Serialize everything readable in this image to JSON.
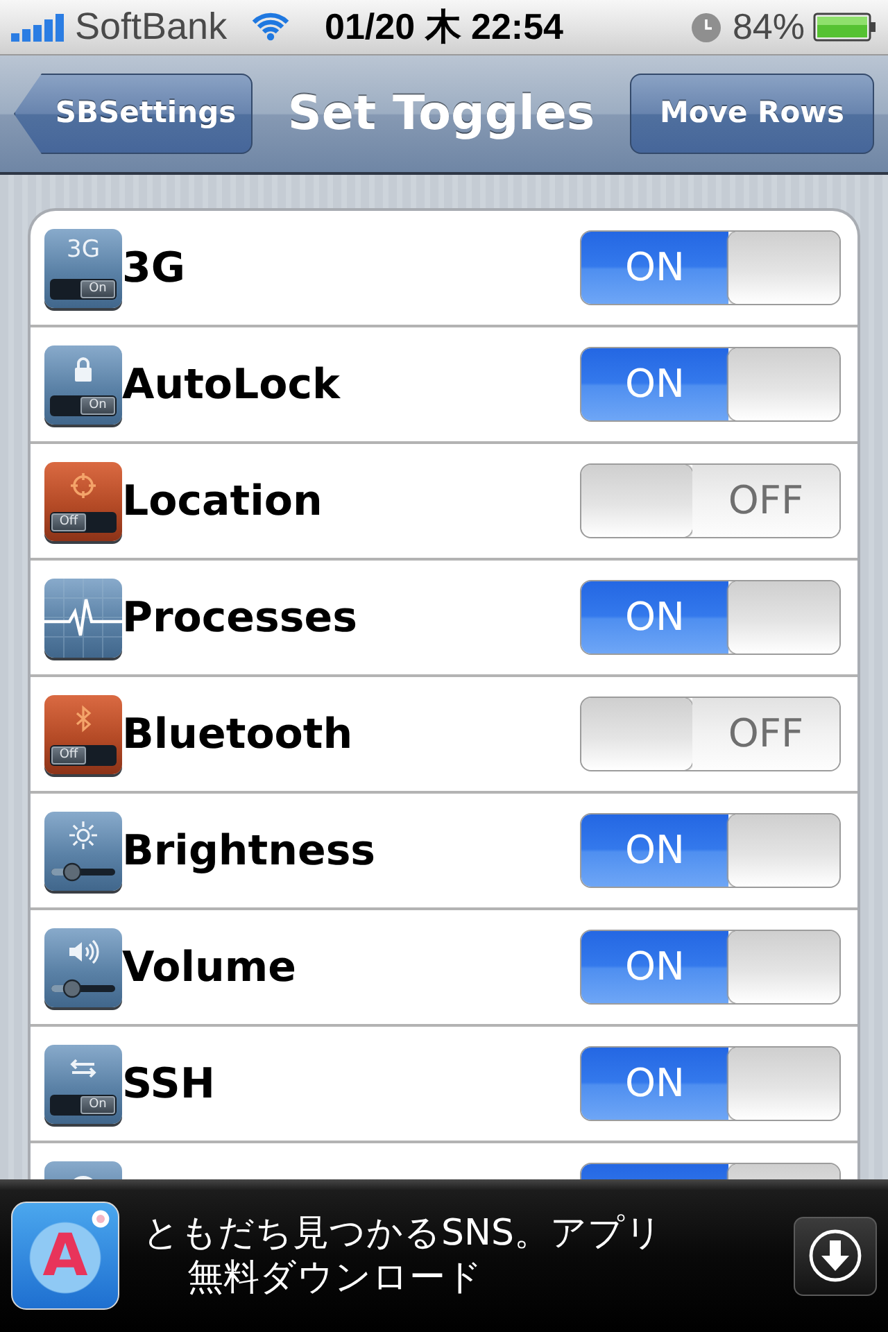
{
  "status_bar": {
    "carrier": "SoftBank",
    "time": "01/20 木 22:54",
    "battery": "84%"
  },
  "nav_bar": {
    "back": "SBSettings",
    "title": "Set Toggles",
    "action": "Move Rows"
  },
  "rows": [
    {
      "name": "3G",
      "on": true,
      "switch_label": "ON",
      "icon": {
        "kind": "switch",
        "label": "3G",
        "switch_text": "On",
        "on": true
      }
    },
    {
      "name": "AutoLock",
      "on": true,
      "switch_label": "ON",
      "icon": {
        "kind": "switch",
        "switch_text": "On",
        "on": true
      }
    },
    {
      "name": "Location",
      "on": false,
      "switch_label": "OFF",
      "icon": {
        "kind": "switch",
        "switch_text": "Off",
        "on": false
      }
    },
    {
      "name": "Processes",
      "on": true,
      "switch_label": "ON",
      "icon": {
        "kind": "graph"
      }
    },
    {
      "name": "Bluetooth",
      "on": false,
      "switch_label": "OFF",
      "icon": {
        "kind": "switch",
        "switch_text": "Off",
        "on": false
      }
    },
    {
      "name": "Brightness",
      "on": true,
      "switch_label": "ON",
      "icon": {
        "kind": "slider"
      }
    },
    {
      "name": "Volume",
      "on": true,
      "switch_label": "ON",
      "icon": {
        "kind": "slider"
      }
    },
    {
      "name": "SSH",
      "on": true,
      "switch_label": "ON",
      "icon": {
        "kind": "switch",
        "switch_text": "On",
        "on": true
      }
    },
    {
      "on": true
    }
  ],
  "ad": {
    "app_icon_letter": "A",
    "lines": [
      "ともだち見つかるSNS。アプリ",
      "無料ダウンロード"
    ]
  }
}
